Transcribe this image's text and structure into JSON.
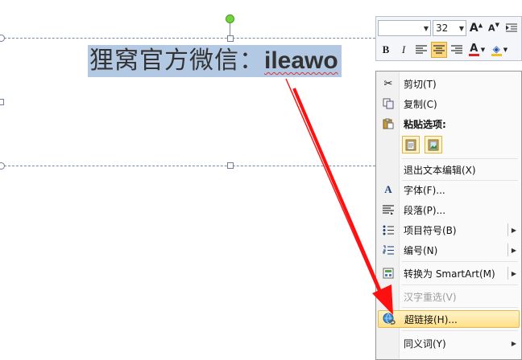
{
  "slide": {
    "selected_text_cjk": "狸窝官方微信：",
    "selected_text_latin": "ileawo"
  },
  "mini_toolbar": {
    "font_name": "",
    "font_size": "32",
    "grow_font": "A",
    "shrink_font": "A",
    "bold": "B",
    "italic": "I",
    "font_color": "A"
  },
  "context_menu": {
    "items": [
      {
        "label": "剪切(T)",
        "icon": "scissors-icon"
      },
      {
        "label": "复制(C)",
        "icon": "copy-icon"
      },
      {
        "label": "粘贴选项:",
        "icon": "paste-icon"
      },
      {
        "label": "退出文本编辑(X)",
        "icon": ""
      },
      {
        "label": "字体(F)...",
        "icon": "font-icon"
      },
      {
        "label": "段落(P)...",
        "icon": "paragraph-icon"
      },
      {
        "label": "项目符号(B)",
        "icon": "bullets-icon"
      },
      {
        "label": "编号(N)",
        "icon": "numbering-icon"
      },
      {
        "label": "转换为 SmartArt(M)",
        "icon": "smartart-icon"
      },
      {
        "label": "汉字重选(V)",
        "icon": ""
      },
      {
        "label": "超链接(H)...",
        "icon": "hyperlink-icon"
      },
      {
        "label": "同义词(Y)",
        "icon": ""
      }
    ]
  },
  "colors": {
    "selection": "#b3c9e3",
    "hover_top": "#fff3c8",
    "hover_bottom": "#ffe08a",
    "arrow": "#ff0000"
  }
}
